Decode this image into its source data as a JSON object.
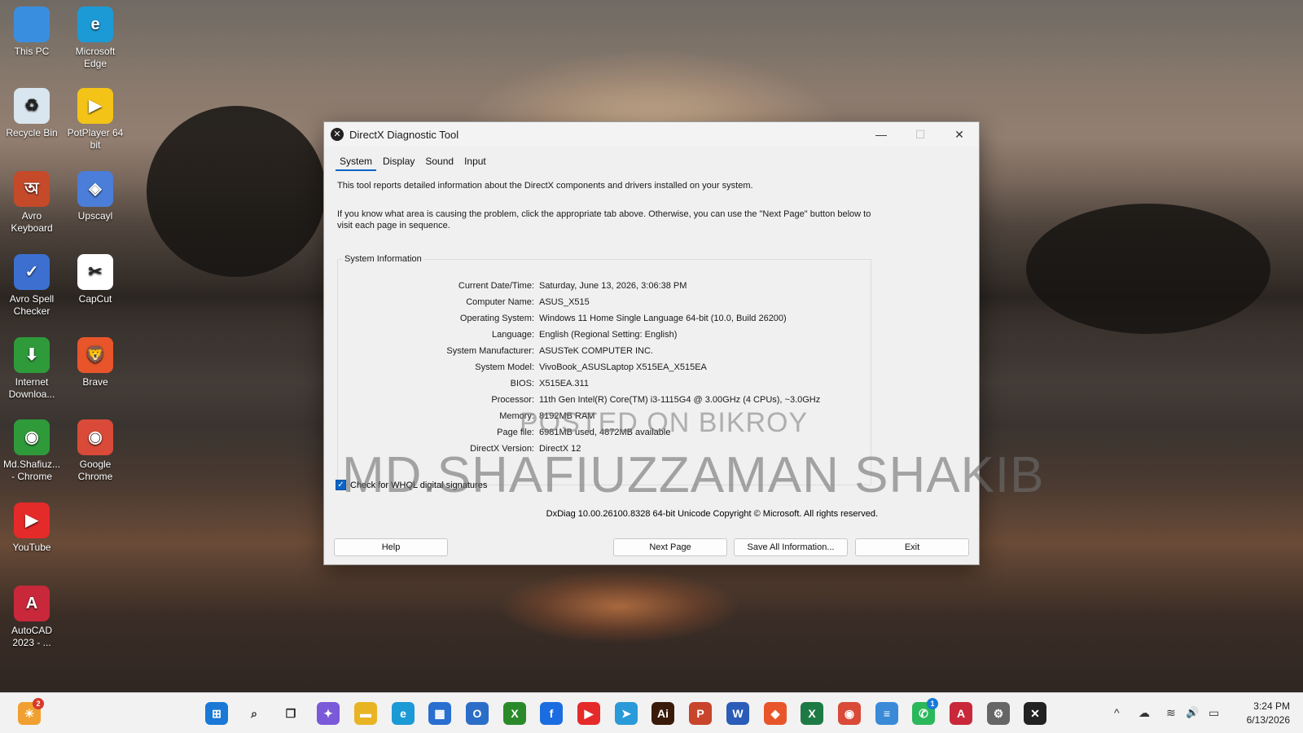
{
  "desktop": {
    "icons": [
      {
        "label": "This PC",
        "icon": "monitor-icon",
        "color": "#3a8ee0",
        "glyph": ""
      },
      {
        "label": "Microsoft Edge",
        "icon": "edge-icon",
        "color": "#1c9ad6",
        "glyph": "e"
      },
      {
        "label": "Recycle Bin",
        "icon": "recycle-bin-icon",
        "color": "#d9e6ef",
        "glyph": "♻"
      },
      {
        "label": "PotPlayer 64 bit",
        "icon": "potplayer-icon",
        "color": "#f3c318",
        "glyph": "▶"
      },
      {
        "label": "Avro Keyboard",
        "icon": "avro-keyboard-icon",
        "color": "#c44a2a",
        "glyph": "অ"
      },
      {
        "label": "Upscayl",
        "icon": "upscayl-icon",
        "color": "#4a7ed8",
        "glyph": "◈"
      },
      {
        "label": "Avro Spell Checker",
        "icon": "avro-spell-icon",
        "color": "#3c6fd0",
        "glyph": "✓"
      },
      {
        "label": "CapCut",
        "icon": "capcut-icon",
        "color": "#ffffff",
        "glyph": "✂"
      },
      {
        "label": "Internet Downloa...",
        "icon": "idm-icon",
        "color": "#2f9a3a",
        "glyph": "⬇"
      },
      {
        "label": "Brave",
        "icon": "brave-icon",
        "color": "#e8552a",
        "glyph": "🦁"
      },
      {
        "label": "Md.Shafiuz... - Chrome",
        "icon": "chrome-profile-icon",
        "color": "#2f9a3a",
        "glyph": "◉"
      },
      {
        "label": "Google Chrome",
        "icon": "chrome-icon",
        "color": "#d94a38",
        "glyph": "◉"
      },
      {
        "label": "YouTube",
        "icon": "youtube-icon",
        "color": "#e52a2a",
        "glyph": "▶"
      },
      {
        "label": "AutoCAD 2023 - ...",
        "icon": "autocad-icon",
        "color": "#c8283a",
        "glyph": "A"
      }
    ]
  },
  "window": {
    "title": "DirectX Diagnostic Tool",
    "minimize": "—",
    "maximize": "☐",
    "close": "✕",
    "tabs": [
      "System",
      "Display",
      "Sound",
      "Input"
    ],
    "intro1": "This tool reports detailed information about the DirectX components and drivers installed on your system.",
    "intro2": "If you know what area is causing the problem, click the appropriate tab above.  Otherwise, you can use the \"Next Page\" button below to visit each page in sequence.",
    "group_title": "System Information",
    "info": [
      {
        "k": "Current Date/Time:",
        "v": "Saturday, June 13, 2026, 3:06:38 PM"
      },
      {
        "k": "Computer Name:",
        "v": "ASUS_X515"
      },
      {
        "k": "Operating System:",
        "v": "Windows 11 Home Single Language 64-bit (10.0, Build 26200)"
      },
      {
        "k": "Language:",
        "v": "English (Regional Setting: English)"
      },
      {
        "k": "System Manufacturer:",
        "v": "ASUSTeK COMPUTER INC."
      },
      {
        "k": "System Model:",
        "v": "VivoBook_ASUSLaptop X515EA_X515EA"
      },
      {
        "k": "BIOS:",
        "v": "X515EA.311"
      },
      {
        "k": "Processor:",
        "v": "11th Gen Intel(R) Core(TM) i3-1115G4 @ 3.00GHz (4 CPUs), ~3.0GHz"
      },
      {
        "k": "Memory:",
        "v": "8192MB RAM"
      },
      {
        "k": "Page file:",
        "v": "6981MB used, 4872MB available"
      },
      {
        "k": "DirectX Version:",
        "v": "DirectX 12"
      }
    ],
    "whql_label": "Check for WHQL digital signatures",
    "whql_checked": "✓",
    "copyright": "DxDiag 10.00.26100.8328 64-bit Unicode  Copyright © Microsoft. All rights reserved.",
    "buttons": {
      "help": "Help",
      "next": "Next Page",
      "save": "Save All Information...",
      "exit": "Exit"
    }
  },
  "watermark": {
    "line1": "POSTED ON BIKROY",
    "line2": "MD.SHAFIUZZAMAN SHAKIB"
  },
  "taskbar": {
    "left_badge": "2",
    "apps": [
      {
        "icon": "start-icon",
        "color": "#1a78d6",
        "glyph": "⊞"
      },
      {
        "icon": "search-icon",
        "color": "#333333",
        "glyph": "⌕"
      },
      {
        "icon": "task-view-icon",
        "color": "#333333",
        "glyph": "❐"
      },
      {
        "icon": "copilot-icon",
        "color": "#7a5ad8",
        "glyph": "✦"
      },
      {
        "icon": "file-explorer-icon",
        "color": "#e8b424",
        "glyph": "▬"
      },
      {
        "icon": "edge-icon",
        "color": "#1c9ad6",
        "glyph": "e"
      },
      {
        "icon": "store-icon",
        "color": "#2a6fd0",
        "glyph": "▦"
      },
      {
        "icon": "outlook-icon",
        "color": "#2b6ec8",
        "glyph": "O"
      },
      {
        "icon": "xbox-icon",
        "color": "#2a8a2a",
        "glyph": "X"
      },
      {
        "icon": "facebook-icon",
        "color": "#1a6de0",
        "glyph": "f"
      },
      {
        "icon": "youtube-icon",
        "color": "#e52a2a",
        "glyph": "▶"
      },
      {
        "icon": "telegram-icon",
        "color": "#2a9ad8",
        "glyph": "➤"
      },
      {
        "icon": "illustrator-icon",
        "color": "#3a1a0a",
        "glyph": "Ai"
      },
      {
        "icon": "powerpoint-icon",
        "color": "#c8442a",
        "glyph": "P"
      },
      {
        "icon": "word-icon",
        "color": "#2a5cb8",
        "glyph": "W"
      },
      {
        "icon": "brave-icon",
        "color": "#e8552a",
        "glyph": "◆"
      },
      {
        "icon": "excel-icon",
        "color": "#1e7a44",
        "glyph": "X"
      },
      {
        "icon": "chrome-icon",
        "color": "#d94a38",
        "glyph": "◉"
      },
      {
        "icon": "notepad-icon",
        "color": "#3a8ad8",
        "glyph": "≡"
      },
      {
        "icon": "whatsapp-icon",
        "color": "#2ab85a",
        "glyph": "✆"
      },
      {
        "icon": "autocad-icon",
        "color": "#c8283a",
        "glyph": "A"
      },
      {
        "icon": "settings-icon",
        "color": "#666666",
        "glyph": "⚙"
      },
      {
        "icon": "directx-icon",
        "color": "#222222",
        "glyph": "✕"
      }
    ],
    "whatsapp_badge": "1",
    "tray": {
      "chevron": "^",
      "network": "☁",
      "wifi": "≋",
      "volume": "🔊",
      "battery": "▭"
    },
    "time": "3:24 PM",
    "date": "6/13/2026"
  }
}
